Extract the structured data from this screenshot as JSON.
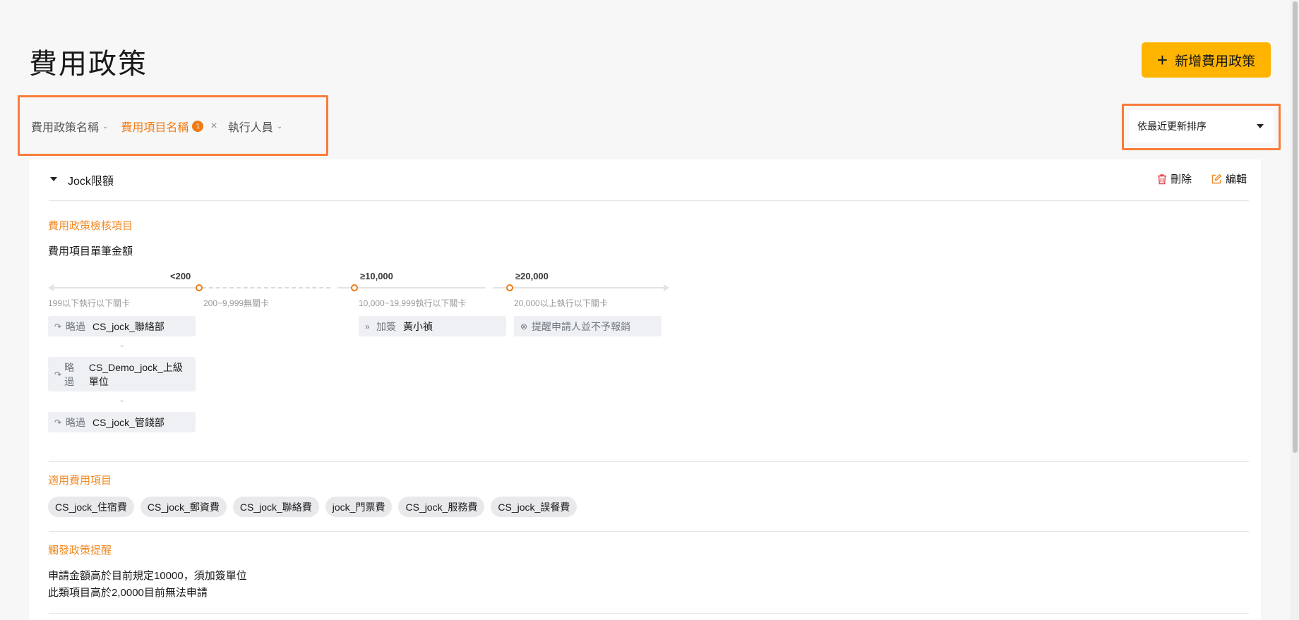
{
  "page": {
    "title": "費用政策",
    "add_button_label": "新增費用政策"
  },
  "filters": {
    "policy_name": "費用政策名稱",
    "expense_item_name": "費用項目名稱",
    "expense_item_count": "1",
    "executor": "執行人員"
  },
  "sort": {
    "selected": "依最近更新排序"
  },
  "policy": {
    "name": "Jock限額",
    "delete_label": "刪除",
    "edit_label": "編輯",
    "check_section_title": "費用政策檢核項目",
    "check_subject": "費用項目單筆金額",
    "thresholds": [
      "<200",
      "≥10,000",
      "≥20,000"
    ],
    "ranges": [
      "199以下執行以下關卡",
      "200~9,999無關卡",
      "10,000~19,999執行以下關卡",
      "20,000以上執行以下關卡"
    ],
    "skip_label": "略過",
    "countersign_label": "加簽",
    "skip_steps": [
      "CS_jock_聯絡部",
      "CS_Demo_jock_上級單位",
      "CS_jock_管錢部"
    ],
    "countersign_person": "黃小禎",
    "reject_label": "提醒申請人並不予報銷",
    "applicable_section_title": "適用費用項目",
    "applicable_items": [
      "CS_jock_住宿費",
      "CS_jock_郵資費",
      "CS_jock_聯絡費",
      "jock_門票費",
      "CS_jock_服務費",
      "CS_jock_誤餐費"
    ],
    "reminder_section_title": "觸發政策提醒",
    "reminders": [
      "申請金額高於目前規定10000，須加簽單位",
      "此類項目高於2,0000目前無法申請"
    ]
  },
  "colors": {
    "accent": "#f07a14",
    "primary_button": "#ffb400",
    "highlight_border": "#fa7c3a",
    "delete_icon": "#e5484d",
    "edit_icon": "#f08a25"
  }
}
